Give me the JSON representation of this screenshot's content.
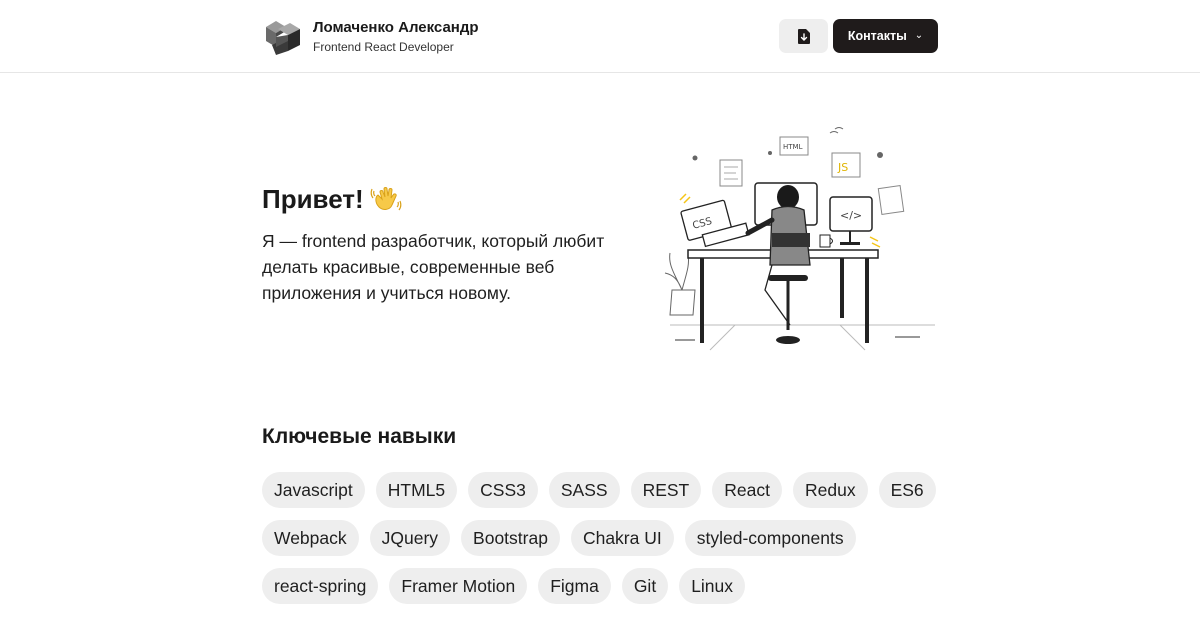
{
  "header": {
    "name": "Ломаченко Александр",
    "role": "Frontend React Developer",
    "download_icon": "file-download-icon",
    "contacts_label": "Контакты",
    "contacts_chevron": "⌄"
  },
  "hero": {
    "title": "Привет!",
    "wave_icon": "waving-hand-icon",
    "text": "Я — frontend разработчик, который любит делать красивые, современные веб приложения и учиться новому.",
    "illustration_labels": {
      "html": "HTML",
      "js": "JS",
      "css": "CSS",
      "code": "</>"
    }
  },
  "skills": {
    "title": "Ключевые навыки",
    "items": [
      "Javascript",
      "HTML5",
      "CSS3",
      "SASS",
      "REST",
      "React",
      "Redux",
      "ES6",
      "Webpack",
      "JQuery",
      "Bootstrap",
      "Chakra UI",
      "styled-components",
      "react-spring",
      "Framer Motion",
      "Figma",
      "Git",
      "Linux"
    ]
  },
  "colors": {
    "accent_dark": "#1f1b1b",
    "tag_bg": "#eeeeee",
    "illustration_yellow": "#f5c518"
  }
}
